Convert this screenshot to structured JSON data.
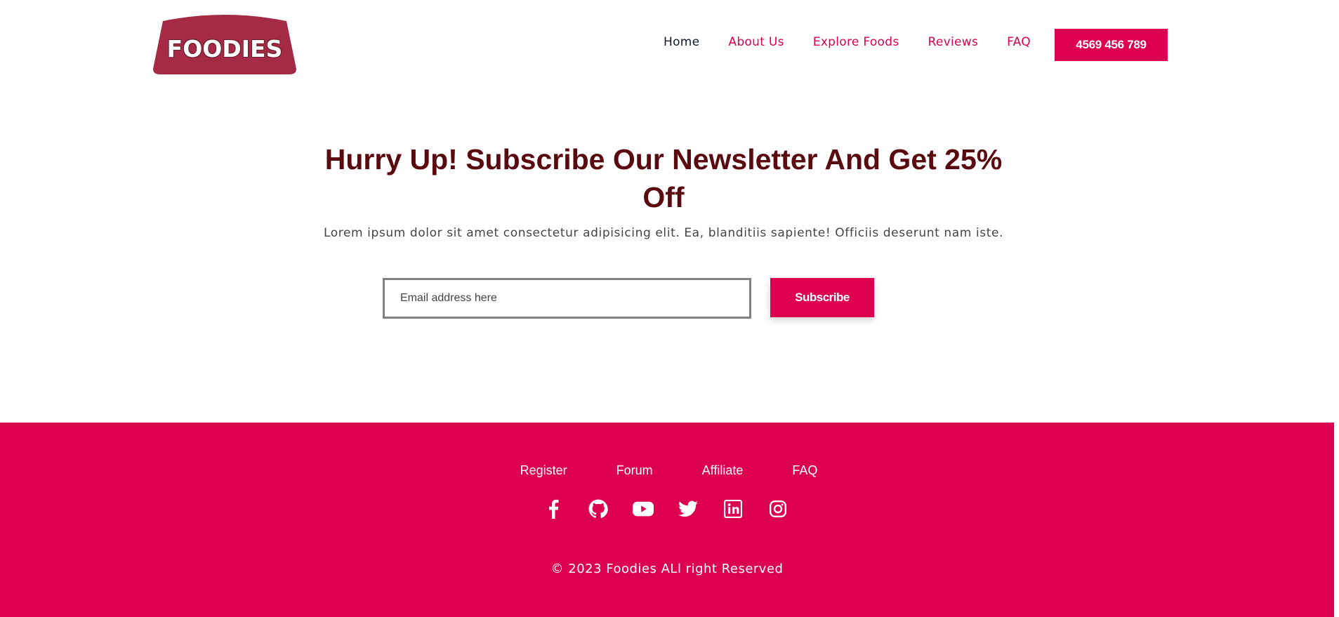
{
  "brand": {
    "logo_text": "FOODIES",
    "logo_color": "#a52a45"
  },
  "nav": {
    "items": [
      {
        "label": "Home",
        "active": true
      },
      {
        "label": "About Us"
      },
      {
        "label": "Explore Foods"
      },
      {
        "label": "Reviews"
      },
      {
        "label": "FAQ"
      }
    ],
    "phone": "4569 456 789"
  },
  "newsletter": {
    "title": "Hurry Up! Subscribe Our Newsletter And Get 25% Off",
    "subtitle": "Lorem ipsum dolor sit amet consectetur adipisicing elit. Ea, blanditiis sapiente! Officiis deserunt nam iste.",
    "email_placeholder": "Email address here",
    "button_label": "Subscribe"
  },
  "footer": {
    "links": [
      "Register",
      "Forum",
      "Affiliate",
      "FAQ"
    ],
    "socials": [
      "facebook-icon",
      "github-icon",
      "youtube-icon",
      "twitter-icon",
      "linkedin-icon",
      "instagram-icon"
    ],
    "copyright": "© 2023 Foodies ALl right Reserved"
  },
  "colors": {
    "accent": "#dc004e",
    "heading": "#5a0a0f",
    "nav_active": "#111827"
  }
}
